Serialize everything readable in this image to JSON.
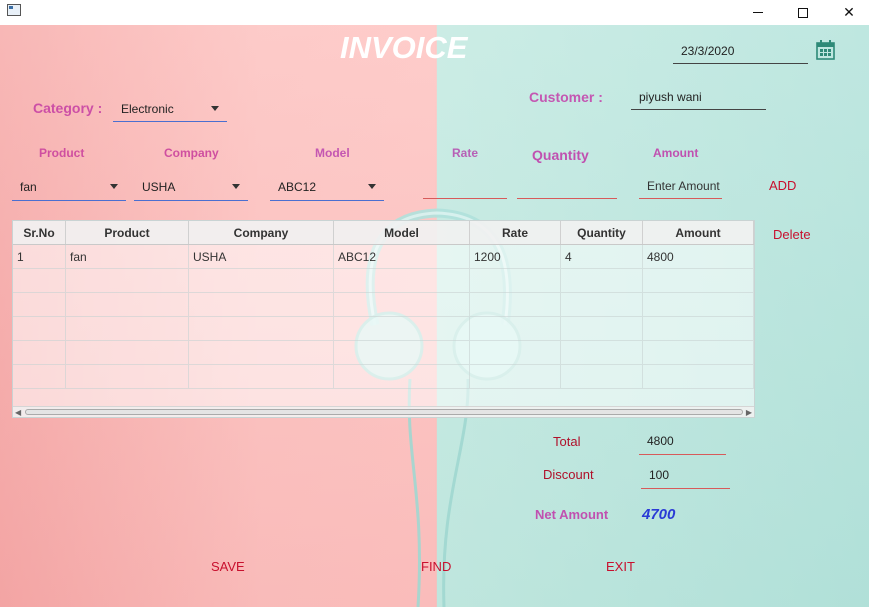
{
  "window": {
    "minimize": "",
    "maximize": "",
    "close": "✕"
  },
  "header": {
    "title": "INVOICE",
    "date": "23/3/2020"
  },
  "form": {
    "category_label": "Category :",
    "category_value": "Electronic",
    "customer_label": "Customer :",
    "customer_value": "piyush wani",
    "product_label": "Product",
    "company_label": "Company",
    "model_label": "Model",
    "rate_label": "Rate",
    "quantity_label": "Quantity",
    "amount_label": "Amount",
    "product_value": "fan",
    "company_value": "USHA",
    "model_value": "ABC12",
    "rate_value": "",
    "quantity_value": "",
    "amount_value": "Enter Amount"
  },
  "actions": {
    "add": "ADD",
    "delete": "Delete",
    "save": "SAVE",
    "find": "FIND",
    "exit": "EXIT"
  },
  "table": {
    "columns": [
      "Sr.No",
      "Product",
      "Company",
      "Model",
      "Rate",
      "Quantity",
      "Amount"
    ],
    "rows": [
      [
        "1",
        "fan",
        "USHA",
        "ABC12",
        "1200",
        "4",
        "4800"
      ]
    ]
  },
  "summary": {
    "total_label": "Total",
    "total_value": "4800",
    "discount_label": "Discount",
    "discount_value": "100",
    "net_label": "Net Amount",
    "net_value": "4700"
  },
  "colors": {
    "accent_red": "#c8102e",
    "net_blue": "#2a3bd6",
    "label_pink": "#c050b0"
  },
  "icons": {
    "calendar": "calendar-icon",
    "dropdown": "chevron-down-icon"
  }
}
